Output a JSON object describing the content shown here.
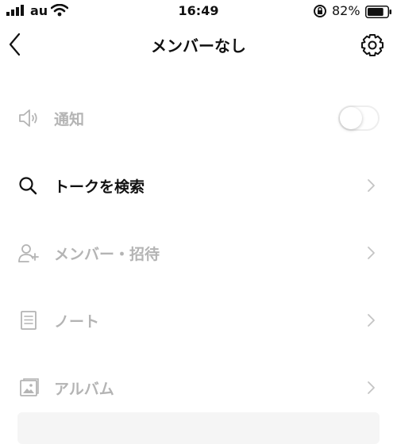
{
  "status_bar": {
    "carrier": "au",
    "time": "16:49",
    "battery_percent": "82%",
    "battery_level": 0.82
  },
  "header": {
    "title": "メンバーなし",
    "back_icon": "chevron-left-icon",
    "settings_icon": "gear-icon"
  },
  "menu": {
    "items": [
      {
        "label": "通知",
        "icon": "speaker-icon",
        "control": "toggle",
        "toggle_on": false
      },
      {
        "label": "トークを検索",
        "icon": "search-icon",
        "control": "chevron"
      },
      {
        "label": "メンバー・招待",
        "icon": "add-user-icon",
        "control": "chevron"
      },
      {
        "label": "ノート",
        "icon": "note-icon",
        "control": "chevron"
      },
      {
        "label": "アルバム",
        "icon": "album-icon",
        "control": "chevron"
      }
    ]
  },
  "colors": {
    "active_text": "#111111",
    "disabled_text": "#b4b4b4",
    "chevron": "#c4c4c4"
  }
}
